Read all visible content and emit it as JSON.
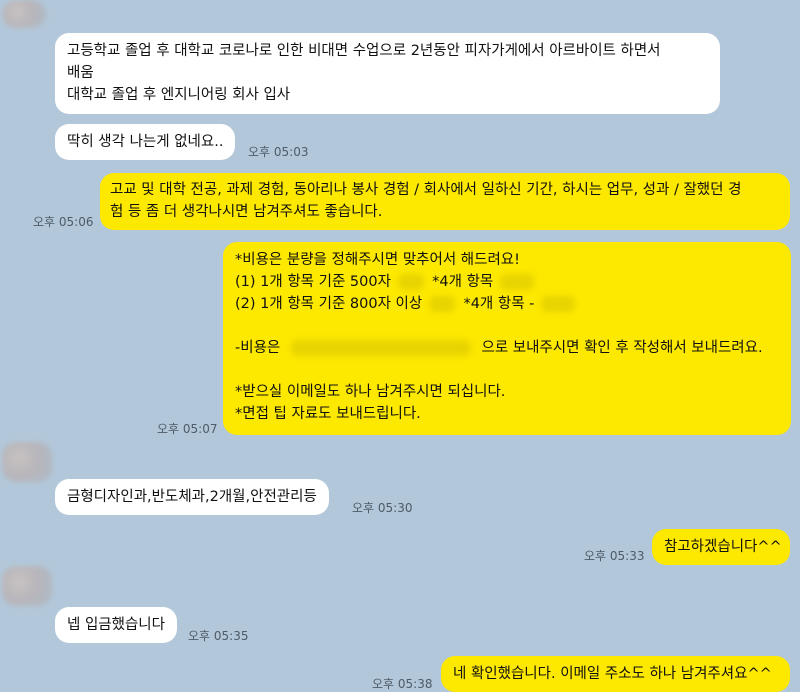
{
  "messages": [
    {
      "lines": [
        "고등학교 졸업 후 대학교 코로나로 인한 비대면 수업으로 2년동안 피자가게에서 아르바이트 하면서",
        "배움",
        "대학교 졸업 후 엔지니어링 회사 입사"
      ]
    },
    {
      "lines": [
        "딱히 생각 나는게 없네요.."
      ],
      "time": "오후 05:03"
    },
    {
      "lines": [
        "고교 및 대학 전공, 과제 경험, 동아리나 봉사 경험 / 회사에서 일하신 기간, 하시는 업무, 성과 / 잘했던 경",
        "험 등 좀 더 생각나시면 남겨주셔도 좋습니다."
      ],
      "time": "오후 05:06"
    },
    {
      "line1": "*비용은 분량을 정해주시면 맞추어서 해드려요!",
      "line2a": "(1) 1개 항목 기준 500자",
      "line2b": "*4개 항목",
      "line3a": "(2) 1개 항목 기준 800자 이상",
      "line3b": "*4개 항목 -",
      "line4a": "-비용은",
      "line4b": "으로 보내주시면 확인 후 작성해서 보내드려요.",
      "line5": "*받으실 이메일도 하나 남겨주시면 되십니다.",
      "line6": "*면접 팁 자료도 보내드립니다.",
      "time": "오후 05:07"
    },
    {
      "lines": [
        "금형디자인과,반도체과,2개월,안전관리등"
      ],
      "time": "오후 05:30"
    },
    {
      "lines": [
        "참고하겠습니다^^"
      ],
      "time": "오후 05:33"
    },
    {
      "lines": [
        "넵 입금했습니다"
      ],
      "time": "오후 05:35"
    },
    {
      "lines": [
        "네 확인했습니다. 이메일 주소도 하나 남겨주셔요^^"
      ],
      "time": "오후 05:38"
    }
  ]
}
